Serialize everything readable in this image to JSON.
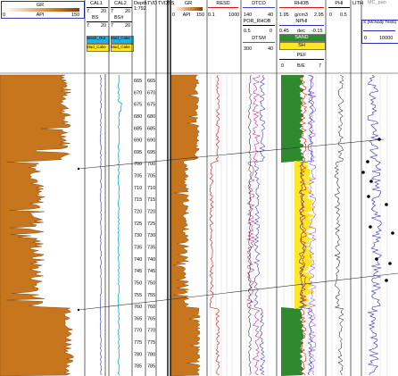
{
  "left_panel": {
    "curve": "GR",
    "unit": "API",
    "min": "0",
    "max": "150"
  },
  "track_cal": {
    "cal1": {
      "name": "CAL1",
      "min": "7",
      "max": "20"
    },
    "cal2": {
      "name": "CAL2",
      "min": "7",
      "max": "20"
    },
    "bs": {
      "name": "BS",
      "min": "7",
      "max": "20"
    },
    "bs_shade": {
      "name": "BS#",
      "min": "7",
      "max": "20"
    },
    "fill_a": "Wash_Out",
    "fill_b": "Mud_Cake",
    "fill_c": "Mud_Cake",
    "fill_d": "Mud_Cake"
  },
  "depth_tracks": {
    "md_label": "Depth",
    "md_value": "1:792",
    "tvd_label": "TVD",
    "tvdss_label": "TVDSS"
  },
  "depths": [
    "665",
    "670",
    "675",
    "680",
    "685",
    "690",
    "695",
    "700",
    "705",
    "710",
    "715",
    "720",
    "725",
    "730",
    "735",
    "740",
    "745",
    "750",
    "755",
    "760",
    "765",
    "770",
    "775",
    "780",
    "785"
  ],
  "track_gr": {
    "name": "GR",
    "unit": "API",
    "min": "0",
    "max": "150"
  },
  "track_res": {
    "name": "RESD",
    "min": "0.1",
    "max": "1000"
  },
  "track_sonic": {
    "dtco": {
      "name": "DTCO",
      "min": "140",
      "max": "40"
    },
    "por": {
      "name": "POR_RHOB",
      "min": "0.5",
      "max": "0"
    },
    "dtsm": {
      "name": "DTSM",
      "min": "300",
      "max": "40"
    }
  },
  "track_density": {
    "rhob": {
      "name": "RHOB",
      "min": "1.95",
      "unit": "g/cm3",
      "max": "2.95"
    },
    "nphi": {
      "name": "NPHI",
      "min": "0.45",
      "unit": "dec",
      "max": "-0.15"
    },
    "fill_1": "SAND",
    "fill_2": "SH",
    "pef": {
      "name": "PEF",
      "min": "0",
      "unit": "B/E",
      "max": "7"
    }
  },
  "track_phi": {
    "name": "PHI",
    "min": "0",
    "max": "0.5"
  },
  "track_lith": {
    "name": "LITH"
  },
  "track_mc": {
    "name": "MC_pan",
    "legend": "S (McNally Tests)",
    "min": "0",
    "max": "10000"
  },
  "colors": {
    "gr_fill": "#c8761e",
    "gr_light": "#f4c884",
    "dense_green": "#2f8a2f",
    "sand_yellow": "#ffe629",
    "cyan": "#1ab3e6",
    "nav_border": "#2b2bb5"
  }
}
